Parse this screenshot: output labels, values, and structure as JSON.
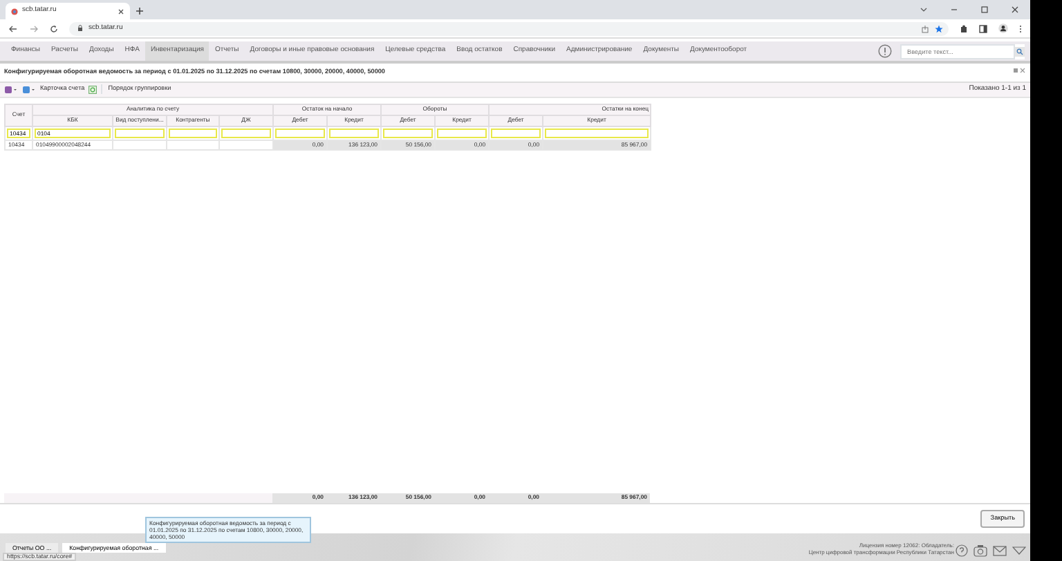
{
  "browser": {
    "tab_title": "scb.tatar.ru",
    "address": "scb.tatar.ru"
  },
  "menu": [
    {
      "label": "Финансы",
      "selected": false
    },
    {
      "label": "Расчеты",
      "selected": false
    },
    {
      "label": "Доходы",
      "selected": false
    },
    {
      "label": "НФА",
      "selected": false
    },
    {
      "label": "Инвентаризация",
      "selected": true
    },
    {
      "label": "Отчеты",
      "selected": false
    },
    {
      "label": "Договоры и иные правовые основания",
      "selected": false
    },
    {
      "label": "Целевые средства",
      "selected": false
    },
    {
      "label": "Ввод остатков",
      "selected": false
    },
    {
      "label": "Справочники",
      "selected": false
    },
    {
      "label": "Администрирование",
      "selected": false
    },
    {
      "label": "Документы",
      "selected": false
    },
    {
      "label": "Документооборот",
      "selected": false
    }
  ],
  "search": {
    "placeholder": "Введите текст..."
  },
  "report_title": "Конфигурируемая оборотная ведомость за период с 01.01.2025 по 31.12.2025 по счетам 10800, 30000, 20000, 40000, 50000",
  "toolbar": {
    "card_button": "Карточка счета",
    "grouping_button": "Порядок группировки",
    "paging": "Показано 1-1 из 1"
  },
  "table": {
    "groups": [
      {
        "label": "Аналитика по счету"
      },
      {
        "label": "Остаток на начало"
      },
      {
        "label": "Обороты"
      },
      {
        "label": "Остатки на конец"
      }
    ],
    "columns": [
      "Счет",
      "КБК",
      "Вид поступлени...",
      "Контрагенты",
      "ДЖ",
      "Дебет",
      "Кредит",
      "Дебет",
      "Кредит",
      "Дебет",
      "Кредит"
    ],
    "filters": [
      "10434",
      "0104"
    ],
    "rows": [
      [
        "10434",
        "01049900002048244",
        null,
        null,
        null,
        "0,00",
        "136 123,00",
        "50 156,00",
        "0,00",
        "0,00",
        "85 967,00"
      ]
    ],
    "totals": [
      "0,00",
      "136 123,00",
      "50 156,00",
      "0,00",
      "0,00",
      "85 967,00"
    ]
  },
  "close_button": "Закрыть",
  "tasks": [
    {
      "label": "Отчеты ОО ...",
      "selected": false
    },
    {
      "label": "Конфигурируемая оборотная ...",
      "selected": true
    }
  ],
  "status_url": "https://scb.tatar.ru/core#",
  "tooltip": "Конфигурируемая оборотная ведомость за период с 01.01.2025 по 31.12.2025 по счетам 10800, 30000, 20000, 40000, 50000",
  "license": [
    "Лицензия номер 12062: Обладатель:",
    "Центр цифровой трансформации Республики Татарстан"
  ]
}
